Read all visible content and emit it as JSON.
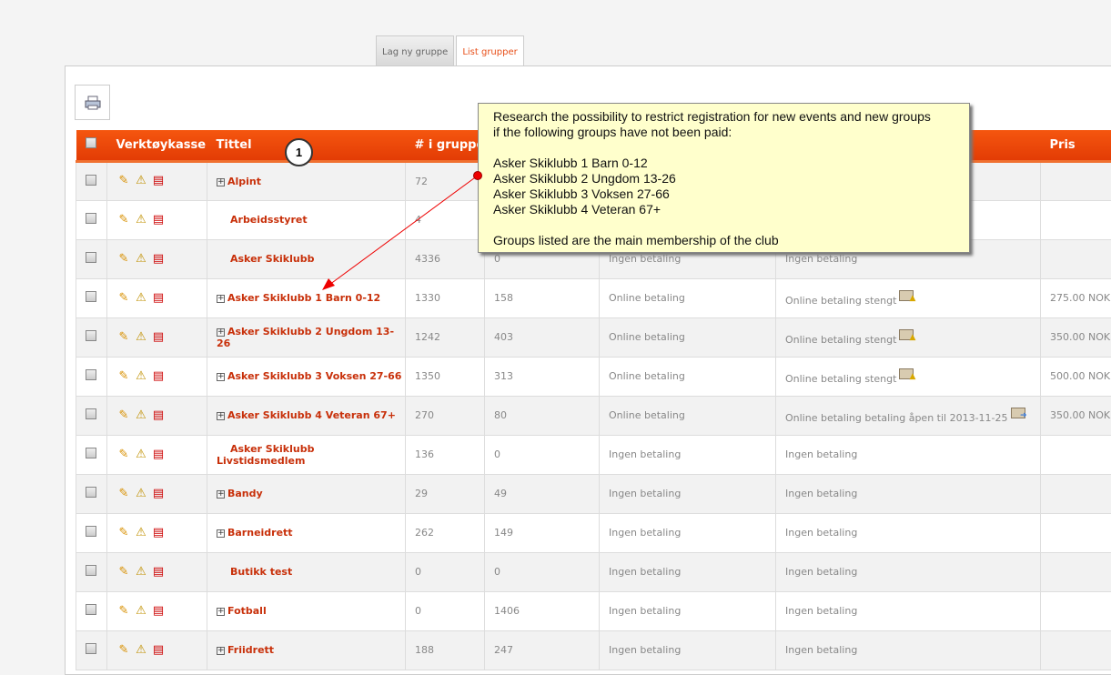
{
  "tabs": [
    {
      "label": "Lag ny gruppe"
    },
    {
      "label": "List grupper",
      "active": true
    }
  ],
  "toolbar": {
    "print_icon": "printer-icon"
  },
  "table": {
    "headers": {
      "tools": "Verktøykasse",
      "title": "Tittel",
      "count": "# i gruppe",
      "pris": "Pris"
    },
    "rows": [
      {
        "title": "Alpint",
        "expand": true,
        "count": "72",
        "c5": "",
        "c6": "",
        "c7": "",
        "pris": ""
      },
      {
        "title": "Arbeidsstyret",
        "expand": false,
        "count": "4",
        "c5": "",
        "c6": "",
        "c7": "",
        "pris": ""
      },
      {
        "title": "Asker Skiklubb",
        "expand": false,
        "count": "4336",
        "c5": "0",
        "c6": "Ingen betaling",
        "c7": "Ingen betaling",
        "pris": ""
      },
      {
        "title": "Asker Skiklubb 1 Barn 0-12",
        "expand": true,
        "count": "1330",
        "c5": "158",
        "c6": "Online betaling",
        "c7": "Online betaling stengt",
        "icon": "closed",
        "pris": "275.00 NOK"
      },
      {
        "title": "Asker Skiklubb 2 Ungdom 13-26",
        "expand": true,
        "count": "1242",
        "c5": "403",
        "c6": "Online betaling",
        "c7": "Online betaling stengt",
        "icon": "closed",
        "pris": "350.00 NOK"
      },
      {
        "title": "Asker Skiklubb 3 Voksen 27-66",
        "expand": true,
        "count": "1350",
        "c5": "313",
        "c6": "Online betaling",
        "c7": "Online betaling stengt",
        "icon": "closed",
        "pris": "500.00 NOK"
      },
      {
        "title": "Asker Skiklubb 4 Veteran 67+",
        "expand": true,
        "count": "270",
        "c5": "80",
        "c6": "Online betaling",
        "c7": "Online betaling betaling åpen til 2013-11-25",
        "icon": "open",
        "pris": "350.00 NOK"
      },
      {
        "title": "Asker Skiklubb Livstidsmedlem",
        "expand": false,
        "count": "136",
        "c5": "0",
        "c6": "Ingen betaling",
        "c7": "Ingen betaling",
        "pris": ""
      },
      {
        "title": "Bandy",
        "expand": true,
        "count": "29",
        "c5": "49",
        "c6": "Ingen betaling",
        "c7": "Ingen betaling",
        "pris": ""
      },
      {
        "title": "Barneidrett",
        "expand": true,
        "count": "262",
        "c5": "149",
        "c6": "Ingen betaling",
        "c7": "Ingen betaling",
        "pris": ""
      },
      {
        "title": "Butikk test",
        "expand": false,
        "count": "0",
        "c5": "0",
        "c6": "Ingen betaling",
        "c7": "Ingen betaling",
        "pris": ""
      },
      {
        "title": "Fotball",
        "expand": true,
        "count": "0",
        "c5": "1406",
        "c6": "Ingen betaling",
        "c7": "Ingen betaling",
        "pris": ""
      },
      {
        "title": "Friidrett",
        "expand": true,
        "count": "188",
        "c5": "247",
        "c6": "Ingen betaling",
        "c7": "Ingen betaling",
        "pris": ""
      }
    ]
  },
  "annotation": {
    "number": "1",
    "text": "Research the possibility to restrict registration for new events and new groups\nif the following groups have not been paid:\n\nAsker Skiklubb 1 Barn 0-12\nAsker Skiklubb 2 Ungdom 13-26\nAsker Skiklubb 3 Voksen 27-66\nAsker Skiklubb 4 Veteran 67+\n\nGroups listed are the main membership of the club"
  }
}
